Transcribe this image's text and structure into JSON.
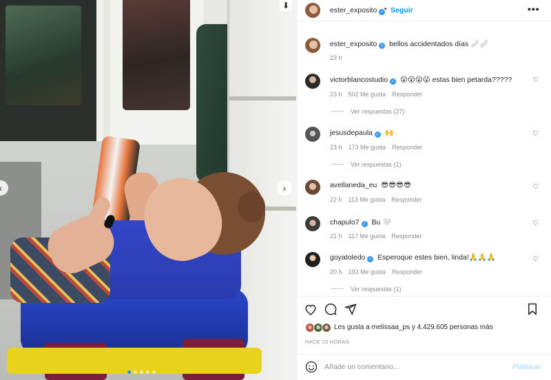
{
  "post": {
    "author": "ester_exposito",
    "follow_label": "Seguir",
    "more_label": "•••",
    "caption": "bellos accidentados días 🩹🩹",
    "caption_time": "23 h"
  },
  "photo": {
    "download_glyph": "⬇",
    "prev_glyph": "‹",
    "next_glyph": "›",
    "slide_count": 5,
    "active_slide": 1
  },
  "comments": [
    {
      "user": "victorblancostudio",
      "verified": true,
      "text": "😮😮😮😮 estas bien petarda?????",
      "time": "23 h",
      "likes": "502 Me gusta",
      "reply": "Responder",
      "view_replies": "Ver respuestas (27)"
    },
    {
      "user": "jesusdepaula",
      "verified": true,
      "text": "🙌",
      "time": "23 h",
      "likes": "173 Me gusta",
      "reply": "Responder",
      "view_replies": "Ver respuestas (1)"
    },
    {
      "user": "avellaneda_eu",
      "verified": false,
      "text": "😎😎😎😎",
      "time": "22 h",
      "likes": "113 Me gusta",
      "reply": "Responder",
      "view_replies": ""
    },
    {
      "user": "chapulo7",
      "verified": true,
      "text": "Bu 🤍",
      "time": "21 h",
      "likes": "117 Me gusta",
      "reply": "Responder",
      "view_replies": ""
    },
    {
      "user": "goyatoledo",
      "verified": true,
      "text": "Esperoque estes bien, linda!🙏🙏🙏",
      "time": "20 h",
      "likes": "193 Me gusta",
      "reply": "Responder",
      "view_replies": "Ver respuestas (1)"
    }
  ],
  "likes_summary": "Les gusta a melissaa_ps y 4.429.605 personas más",
  "time_ago": "HACE 23 HORAS",
  "add_comment": {
    "placeholder": "Añade un comentario...",
    "publish_label": "Publicar"
  },
  "colors": {
    "accent": "#0095f6",
    "verified": "#3897f0",
    "muted": "#8e8e8e",
    "publish_disabled": "#b2dffc"
  }
}
